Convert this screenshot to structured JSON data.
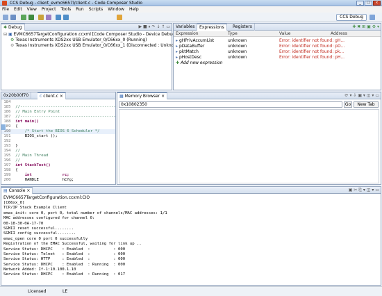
{
  "window": {
    "title": "CCS Debug - client_evmc6657l/client.c - Code Composer Studio"
  },
  "menu": [
    "File",
    "Edit",
    "View",
    "Project",
    "Tools",
    "Run",
    "Scripts",
    "Window",
    "Help"
  ],
  "perspective": "CCS Debug",
  "debug_view": {
    "tab": "Debug",
    "items": [
      "EVMC6657TargetConfiguration.ccxml [Code Composer Studio - Device Debugging]",
      "Texas Instruments XDS2xx USB Emulator_0/C66xx_0 (Running)",
      "Texas Instruments XDS2xx USB Emulator_0/C66xx_1 (Disconnected : Unknown)"
    ]
  },
  "expressions_view": {
    "tabs": [
      "Variables",
      "Expressions",
      "Registers"
    ],
    "columns": [
      "Expression",
      "Type",
      "Value",
      "Address"
    ],
    "rows": [
      {
        "expr": "gHPrivAccumList",
        "type": "unknown",
        "value": "Error: identifier not found: gH..."
      },
      {
        "expr": "pDataBuffer",
        "type": "unknown",
        "value": "Error: identifier not found: pD..."
      },
      {
        "expr": "pktMatch",
        "type": "unknown",
        "value": "Error: identifier not found: pk..."
      },
      {
        "expr": "pHostDesc",
        "type": "unknown",
        "value": "Error: identifier not found: pH..."
      }
    ],
    "add_new": "Add new expression"
  },
  "editor": {
    "tabs": [
      "0x20b00f70",
      "client.c"
    ],
    "lines": [
      {
        "n": "184",
        "text": ""
      },
      {
        "n": "185",
        "text": "//------------------------------------------------"
      },
      {
        "n": "186",
        "text": "// Main Entry Point"
      },
      {
        "n": "187",
        "text": "//------------------------------------------------"
      },
      {
        "n": "188",
        "text": "int main()"
      },
      {
        "n": "189",
        "text": "{"
      },
      {
        "n": "190",
        "text": "    /* Start the BIOS 6 Scheduler */"
      },
      {
        "n": "191",
        "text": "    BIOS_start ();"
      },
      {
        "n": "192",
        "text": ""
      },
      {
        "n": "193",
        "text": "}"
      },
      {
        "n": "194",
        "text": "//"
      },
      {
        "n": "195",
        "text": "// Main Thread"
      },
      {
        "n": "196",
        "text": "//"
      },
      {
        "n": "197",
        "text": "int StackTest()"
      },
      {
        "n": "198",
        "text": "{"
      },
      {
        "n": "199",
        "text": "    int             rc;"
      },
      {
        "n": "200",
        "text": "    HANDLE          hCfg;"
      }
    ]
  },
  "memory_browser": {
    "tab": "Memory Browser",
    "address": "0x10802350",
    "go_label": "Go",
    "new_tab_label": "New Tab"
  },
  "console": {
    "tab": "Console",
    "config": "EVMC6657TargetConfiguration.ccxml:CIO",
    "lines": [
      "[C66xx_0]",
      "TCP/IP Stack Example Client",
      "emac_init: core 0, port 0, total number of channels/MAC addresses: 1/1",
      "MAC addresses configured for channel 0:",
      "00-18-30-0A-17-70",
      "SGMII reset successful........",
      "SGMII config successful........",
      "emac_open core 0 port 0 successfully",
      "Registration of the EMAC Successful, waiting for link up ..",
      "Service Status: DHCPC    : Enabled  :          : 000",
      "Service Status: Telnet   : Enabled  :          : 000",
      "Service Status: HTTP     : Enabled  :          : 000",
      "Service Status: DHCPC    : Enabled  : Running  : 000",
      "Network Added: If-1:10.100.1.10",
      "Service Status: DHCPC    : Enabled  : Running  : 017"
    ]
  },
  "status": {
    "license": "Licensed",
    "mode": "LE"
  },
  "colors": {
    "error": "#c0271b",
    "comment": "#3f7f5f",
    "keyword": "#7f0055"
  }
}
